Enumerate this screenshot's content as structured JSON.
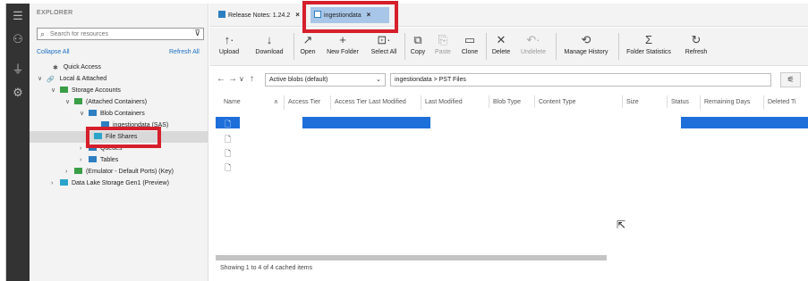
{
  "sidebar": {
    "title": "EXPLORER",
    "search_placeholder": "Search for resources",
    "collapse_all": "Collapse All",
    "refresh_all": "Refresh All",
    "tree": [
      {
        "label": "Quick Access",
        "icon": "pin-icon",
        "twisty": ""
      },
      {
        "label": "Local & Attached",
        "icon": "link-icon",
        "twisty": "∨"
      },
      {
        "label": "Storage Accounts",
        "icon": "storage-icon",
        "twisty": "∨"
      },
      {
        "label": "(Attached Containers)",
        "icon": "storage-icon",
        "twisty": "∨"
      },
      {
        "label": "Blob Containers",
        "icon": "blob-icon",
        "twisty": "∨"
      },
      {
        "label": "ingestiondata (SAS)",
        "icon": "container-icon",
        "twisty": ""
      },
      {
        "label": "File Shares",
        "icon": "fileshare-icon",
        "twisty": ""
      },
      {
        "label": "Queues",
        "icon": "queue-icon",
        "twisty": "›"
      },
      {
        "label": "Tables",
        "icon": "table-icon",
        "twisty": "›"
      },
      {
        "label": "(Emulator - Default Ports) (Key)",
        "icon": "storage-icon",
        "twisty": "›"
      },
      {
        "label": "Data Lake Storage Gen1 (Preview)",
        "icon": "datalake-icon",
        "twisty": "›"
      }
    ]
  },
  "tabs": [
    {
      "label": "Release Notes: 1.24.2",
      "close": "×"
    },
    {
      "label": "ingestiondata",
      "close": "×"
    }
  ],
  "toolbar": [
    {
      "label": "Upload",
      "glyph": "↑·",
      "icon": "upload-icon",
      "enabled": true
    },
    {
      "label": "Download",
      "glyph": "↓",
      "icon": "download-icon",
      "enabled": true
    },
    {
      "label": "Open",
      "glyph": "↗",
      "icon": "open-icon",
      "enabled": true
    },
    {
      "label": "New Folder",
      "glyph": "+",
      "icon": "plus-icon",
      "enabled": true
    },
    {
      "label": "Select All",
      "glyph": "⊡·",
      "icon": "select-all-icon",
      "enabled": true
    },
    {
      "label": "Copy",
      "glyph": "⧉",
      "icon": "copy-icon",
      "enabled": true
    },
    {
      "label": "Paste",
      "glyph": "⎘",
      "icon": "paste-icon",
      "enabled": false
    },
    {
      "label": "Clone",
      "glyph": "▭",
      "icon": "clone-icon",
      "enabled": true
    },
    {
      "label": "Delete",
      "glyph": "✕",
      "icon": "delete-icon",
      "enabled": true
    },
    {
      "label": "Undelete",
      "glyph": "↶·",
      "icon": "undelete-icon",
      "enabled": false
    },
    {
      "label": "Manage History",
      "glyph": "⟲",
      "icon": "history-icon",
      "enabled": true
    },
    {
      "label": "Folder Statistics",
      "glyph": "Σ",
      "icon": "sigma-icon",
      "enabled": true
    },
    {
      "label": "Refresh",
      "glyph": "↻",
      "icon": "refresh-icon",
      "enabled": true
    }
  ],
  "address": {
    "view_mode": "Active blobs (default)",
    "path": "ingestiondata  >  PST Files"
  },
  "columns": [
    "Name",
    "Access Tier",
    "Access Tier Last Modified",
    "Last Modified",
    "Blob Type",
    "Content Type",
    "Size",
    "Status",
    "Remaining Days",
    "Deleted Ti"
  ],
  "rows": 4,
  "status": "Showing 1 to 4 of 4 cached items",
  "colors": {
    "selection": "#1e6fd9",
    "highlight": "#d61f2b",
    "active_tab": "#a8c6e8"
  }
}
